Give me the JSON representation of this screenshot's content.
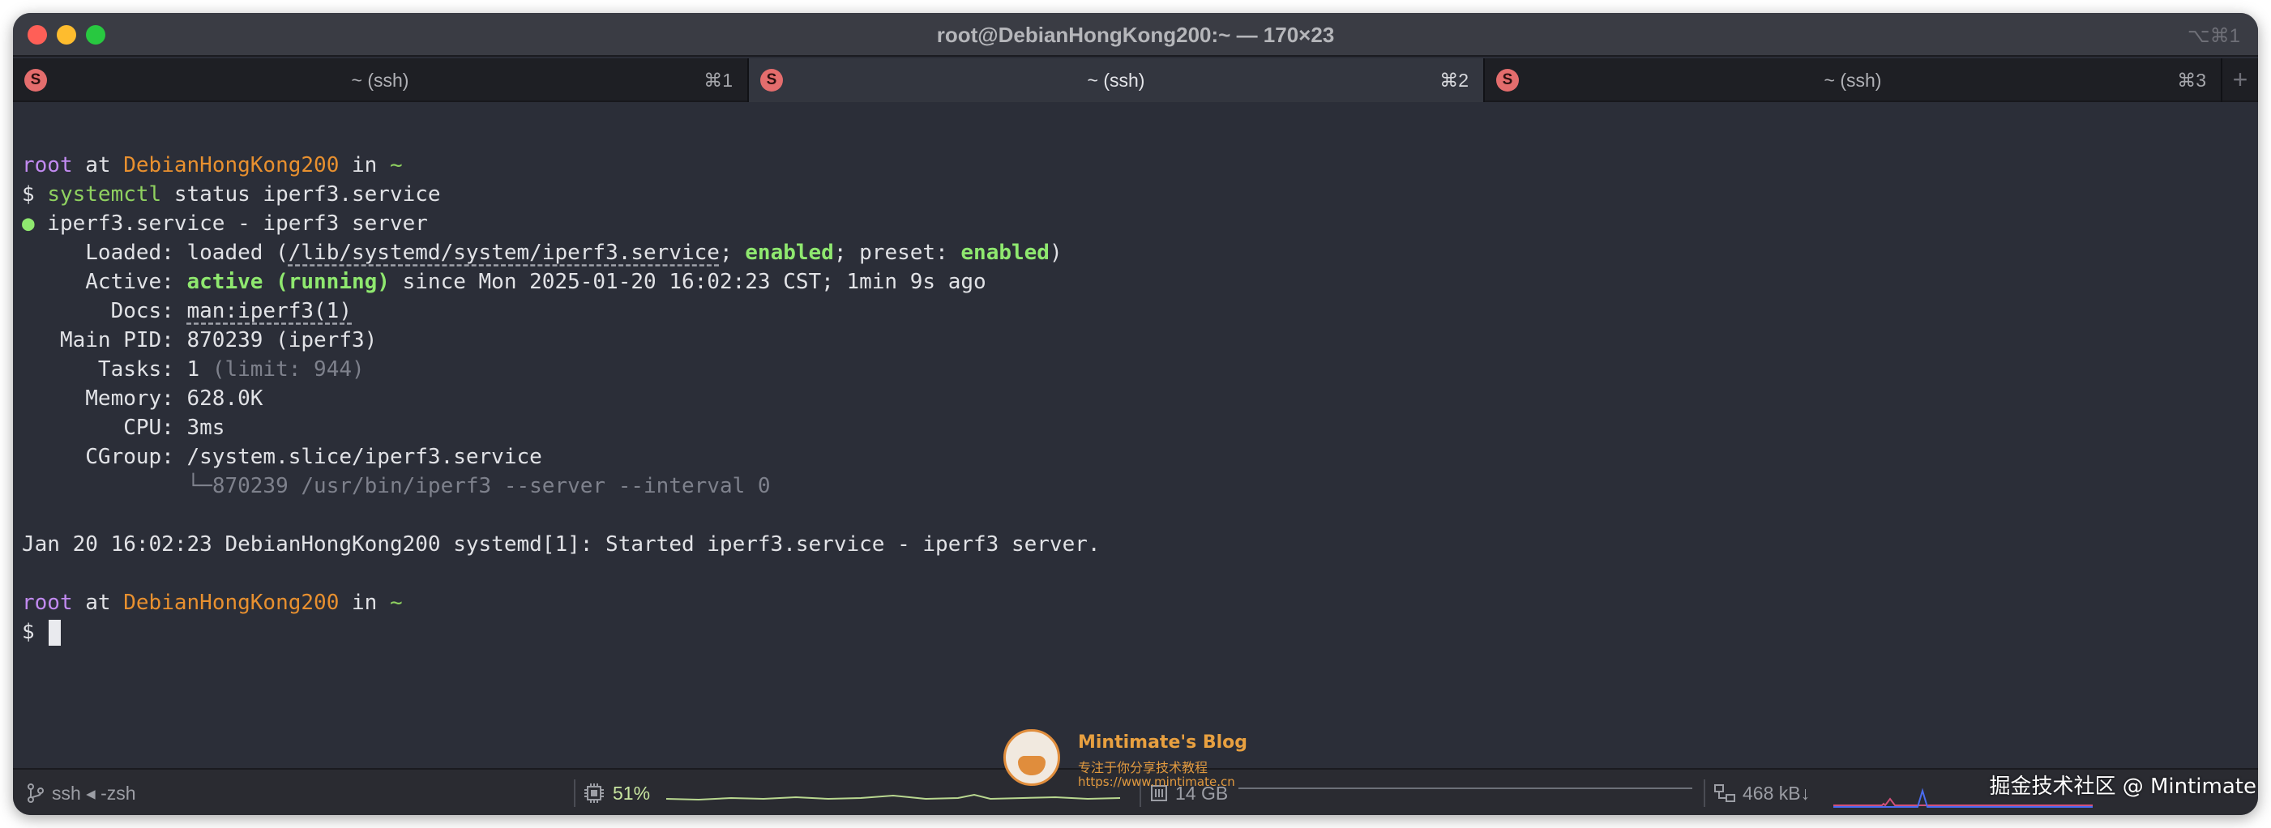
{
  "window": {
    "title": "root@DebianHongKong200:~ — 170×23",
    "shortcut": "⌥⌘1"
  },
  "tabs": [
    {
      "icon": "S",
      "label": "~ (ssh)",
      "key": "⌘1"
    },
    {
      "icon": "S",
      "label": "~ (ssh)",
      "key": "⌘2"
    },
    {
      "icon": "S",
      "label": "~ (ssh)",
      "key": "⌘3"
    }
  ],
  "new_tab": "+",
  "terminal": {
    "prompt1": {
      "user": "root",
      "at": " at ",
      "host": "DebianHongKong200",
      "in": " in ",
      "dir": "~"
    },
    "command": {
      "symbol": "$ ",
      "cmd": "systemctl",
      "args": " status iperf3.service"
    },
    "service_line": {
      "bullet": "●",
      "text": " iperf3.service - iperf3 server"
    },
    "loaded": {
      "label": "     Loaded: ",
      "state": "loaded (",
      "path": "/lib/systemd/system/iperf3.service",
      "sep1": "; ",
      "enabled": "enabled",
      "sep2": "; preset: ",
      "preset": "enabled",
      "close": ")"
    },
    "active": {
      "label": "     Active: ",
      "state": "active (running)",
      "rest": " since Mon 2025-01-20 16:02:23 CST; 1min 9s ago"
    },
    "docs": {
      "label": "       Docs: ",
      "value": "man:iperf3(1)"
    },
    "main_pid": {
      "label": "   Main PID: ",
      "value": "870239 (iperf3)"
    },
    "tasks": {
      "label": "      Tasks: ",
      "value": "1",
      "limit": " (limit: 944)"
    },
    "memory": {
      "label": "     Memory: ",
      "value": "628.0K"
    },
    "cpu": {
      "label": "        CPU: ",
      "value": "3ms"
    },
    "cgroup": {
      "label": "     CGroup: ",
      "value": "/system.slice/iperf3.service"
    },
    "cgroup_child": {
      "indent": "             └─",
      "value": "870239 /usr/bin/iperf3 --server --interval 0"
    },
    "log_line": "Jan 20 16:02:23 DebianHongKong200 systemd[1]: Started iperf3.service - iperf3 server.",
    "prompt2": {
      "user": "root",
      "at": " at ",
      "host": "DebianHongKong200",
      "in": " in ",
      "dir": "~"
    },
    "prompt2_symbol": "$ "
  },
  "statusbar": {
    "session": "ssh ◂ -zsh",
    "cpu_percent": "51%",
    "memory": "14 GB",
    "network": "468 kB↓"
  },
  "watermarks": {
    "blog_name": "Mintimate's Blog",
    "blog_sub": "专注于你分享技术教程",
    "blog_url": "https://www.mintimate.cn",
    "juejin": "掘金技术社区 @ Mintimate"
  },
  "colors": {
    "terminal_bg": "#2b2e38",
    "user": "#c18af0",
    "host": "#e8902f",
    "path": "#8fd160",
    "enabled": "#8fe86f"
  }
}
